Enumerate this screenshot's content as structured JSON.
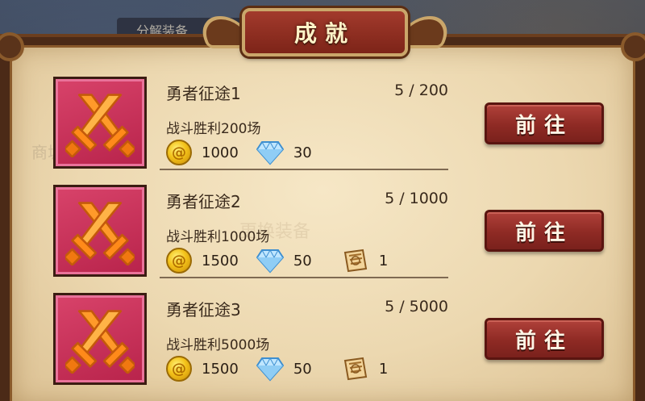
{
  "background": {
    "ghost_tab_label": "分解装备",
    "ghost_middle_label": "更换装备",
    "ghost_left_label": "商城"
  },
  "dialog": {
    "title": "成就",
    "colors": {
      "title_plaque": "#8d2c20",
      "button": "#9a3029",
      "icon_box": "#c92f58",
      "parchment": "#f0dfbc"
    }
  },
  "achievements": [
    {
      "name": "勇者征途1",
      "progress": "5 / 200",
      "progress_fraction": 0.025,
      "description": "战斗胜利200场",
      "rewards": [
        {
          "icon": "gold-coin-icon",
          "value": "1000"
        },
        {
          "icon": "diamond-icon",
          "value": "30"
        }
      ],
      "button_label": "前往"
    },
    {
      "name": "勇者征途2",
      "progress": "5 / 1000",
      "progress_fraction": 0.005,
      "description": "战斗胜利1000场",
      "rewards": [
        {
          "icon": "gold-coin-icon",
          "value": "1500"
        },
        {
          "icon": "diamond-icon",
          "value": "50"
        },
        {
          "icon": "scroll-icon",
          "value": "1"
        }
      ],
      "button_label": "前往"
    },
    {
      "name": "勇者征途3",
      "progress": "5 / 5000",
      "progress_fraction": 0.001,
      "description": "战斗胜利5000场",
      "rewards": [
        {
          "icon": "gold-coin-icon",
          "value": "1500"
        },
        {
          "icon": "diamond-icon",
          "value": "50"
        },
        {
          "icon": "scroll-icon",
          "value": "1"
        }
      ],
      "button_label": "前往"
    }
  ]
}
